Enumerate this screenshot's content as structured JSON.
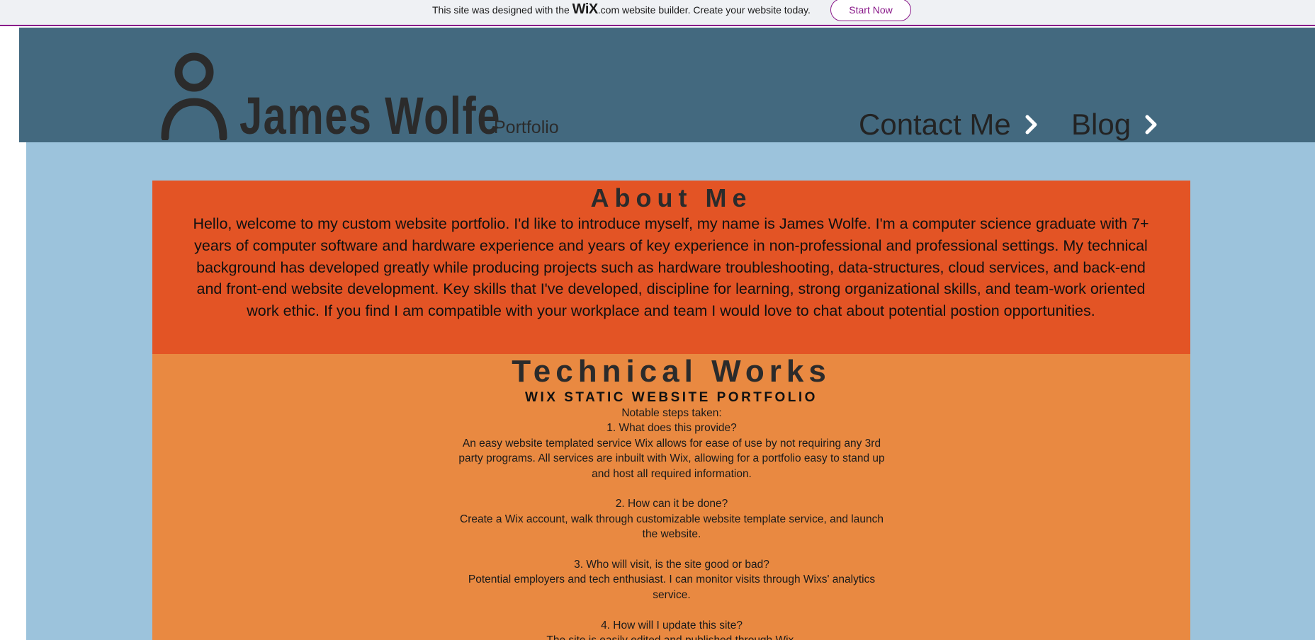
{
  "wix_banner": {
    "text_before": "This site was designed with the",
    "logo": "WiX",
    "text_after": ".com website builder. Create your website today.",
    "button_label": "Start Now"
  },
  "header": {
    "site_name": "James Wolfe",
    "tagline": "Portfolio",
    "nav": [
      {
        "label": "Contact Me",
        "icon": "chevron-right-icon"
      },
      {
        "label": "Blog",
        "icon": "chevron-right-icon"
      }
    ]
  },
  "about": {
    "title": "About Me",
    "body": "Hello, welcome to my custom website portfolio. I'd like to introduce myself, my name is James Wolfe. I'm a computer science graduate with 7+ years of computer software and hardware experience and years of key experience in non-professional and professional settings. My technical background has developed greatly while producing projects such as hardware troubleshooting, data-structures, cloud services, and back-end and front-end website development. Key skills that I've developed, discipline for learning, strong organizational skills, and team-work oriented work ethic. If you find I am compatible with your workplace and team I would love to chat about potential postion opportunities."
  },
  "works": {
    "title": "Technical Works",
    "subtitle": "WIX STATIC WEBSITE PORTFOLIO",
    "intro": "Notable steps taken:",
    "steps": [
      {
        "question": "1. What does this provide?",
        "answer": "An easy website templated service Wix allows for ease of use by not requiring any 3rd party programs. All services are inbuilt with Wix, allowing for a portfolio easy to stand up and host all required information."
      },
      {
        "question": "2. How can it be done?",
        "answer": "Create a Wix account, walk through customizable website template service, and launch the website."
      },
      {
        "question": "3. Who will visit, is the site good or bad?",
        "answer": "Potential employers and tech enthusiast. I can monitor visits through Wixs' analytics service."
      },
      {
        "question": "4. How will I update this site?",
        "answer": "The site is easily edited and published through Wix."
      }
    ]
  },
  "colors": {
    "header_bg": "#43697f",
    "page_bg": "#9cc3dc",
    "about_bg": "#e35425",
    "works_bg": "#e98941",
    "wix_accent": "#8a1a8a"
  }
}
